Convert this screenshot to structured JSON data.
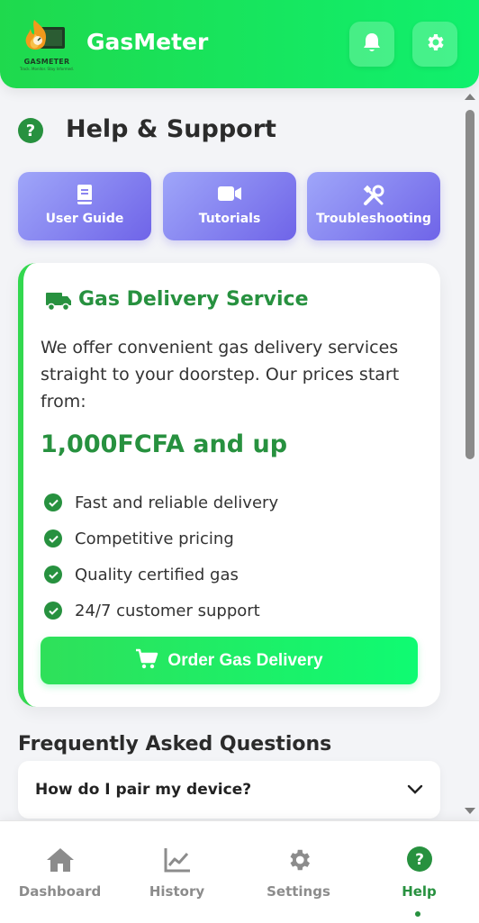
{
  "header": {
    "app_title": "GasMeter",
    "logo_text": "GASMETER",
    "logo_subtext": "Track. Monitor. Stay Informed.",
    "bell_icon": "bell-icon",
    "settings_icon": "gear-icon"
  },
  "help": {
    "title": "Help & Support",
    "quick_links": [
      {
        "label": "User Guide",
        "icon": "book-icon"
      },
      {
        "label": "Tutorials",
        "icon": "video-icon"
      },
      {
        "label": "Troubleshooting",
        "icon": "tools-icon"
      }
    ]
  },
  "delivery": {
    "title": "Gas Delivery Service",
    "description": "We offer convenient gas delivery services straight to your doorstep. Our prices start from:",
    "price": "1,000FCFA and up",
    "features": [
      "Fast and reliable delivery",
      "Competitive pricing",
      "Quality certified gas",
      "24/7 customer support"
    ],
    "order_button": "Order Gas Delivery"
  },
  "faq": {
    "title": "Frequently Asked Questions",
    "items": [
      {
        "question": "How do I pair my device?"
      }
    ]
  },
  "nav": {
    "items": [
      {
        "label": "Dashboard",
        "icon": "home-icon"
      },
      {
        "label": "History",
        "icon": "chart-line-icon"
      },
      {
        "label": "Settings",
        "icon": "gear-icon"
      },
      {
        "label": "Help",
        "icon": "question-icon",
        "active": true
      }
    ]
  },
  "colors": {
    "brand_green": "#27913f",
    "header_gradient_start": "#1fd94d",
    "header_gradient_end": "#10f06d",
    "quick_button_start": "#9fa6f9",
    "quick_button_end": "#6f64e8"
  }
}
